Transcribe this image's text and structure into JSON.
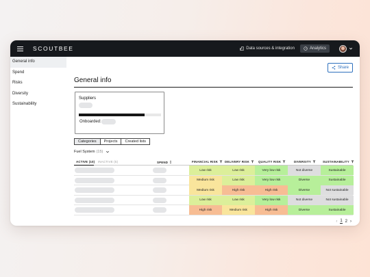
{
  "topbar": {
    "logo": "SCOUTBEE",
    "nav": [
      {
        "label": "Data sources & integration",
        "icon": "building-icon"
      },
      {
        "label": "Analytics",
        "icon": "gauge-icon"
      }
    ]
  },
  "sidebar": {
    "items": [
      {
        "label": "General info",
        "active": true
      },
      {
        "label": "Spend"
      },
      {
        "label": "Risks"
      },
      {
        "label": "Diversity"
      },
      {
        "label": "Sustainability"
      }
    ]
  },
  "main": {
    "share_label": "Share",
    "title": "General info",
    "suppliers_card": {
      "title": "Suppliers",
      "progress": 0.8,
      "onboarded_label": "Onboarded:"
    },
    "tabs": [
      "Categories",
      "Projects",
      "Created lists"
    ],
    "filter": {
      "label": "Fuel System",
      "count": "(15)"
    },
    "table": {
      "subtabs": {
        "active": "ACTIVE (10)",
        "inactive": "INACTIVE (5)"
      },
      "columns": [
        "SPEND",
        "FINANCIAL RISK",
        "DELIVERY RISK",
        "QUALITY RISK",
        "DIVERSITY",
        "SUSTAINABILITY"
      ],
      "rows": [
        [
          "Low risk",
          "Low risk",
          "Very low risk",
          "Not diverse",
          "Sustainable"
        ],
        [
          "Medium risk",
          "Low risk",
          "Very low risk",
          "Diverse",
          "Sustainable"
        ],
        [
          "Medium risk",
          "High risk",
          "High risk",
          "Diverse",
          "Not sustainable"
        ],
        [
          "Low risk",
          "Low risk",
          "Very low risk",
          "Not diverse",
          "Not sustainable"
        ],
        [
          "High risk",
          "Medium risk",
          "High risk",
          "Diverse",
          "Sustainable"
        ]
      ]
    },
    "pagination": {
      "pages": [
        "1",
        "2"
      ],
      "current": "1"
    }
  },
  "colors": {
    "Very low risk": "#b7ef9a",
    "Low risk": "#dcef9a",
    "Medium risk": "#f9e59c",
    "High risk": "#f7bd94",
    "Not diverse": "#dededf",
    "Diverse": "#b7ef9a",
    "Sustainable": "#b7ef9a",
    "Not sustainable": "#dededf",
    "accent": "#2c6fbd"
  }
}
